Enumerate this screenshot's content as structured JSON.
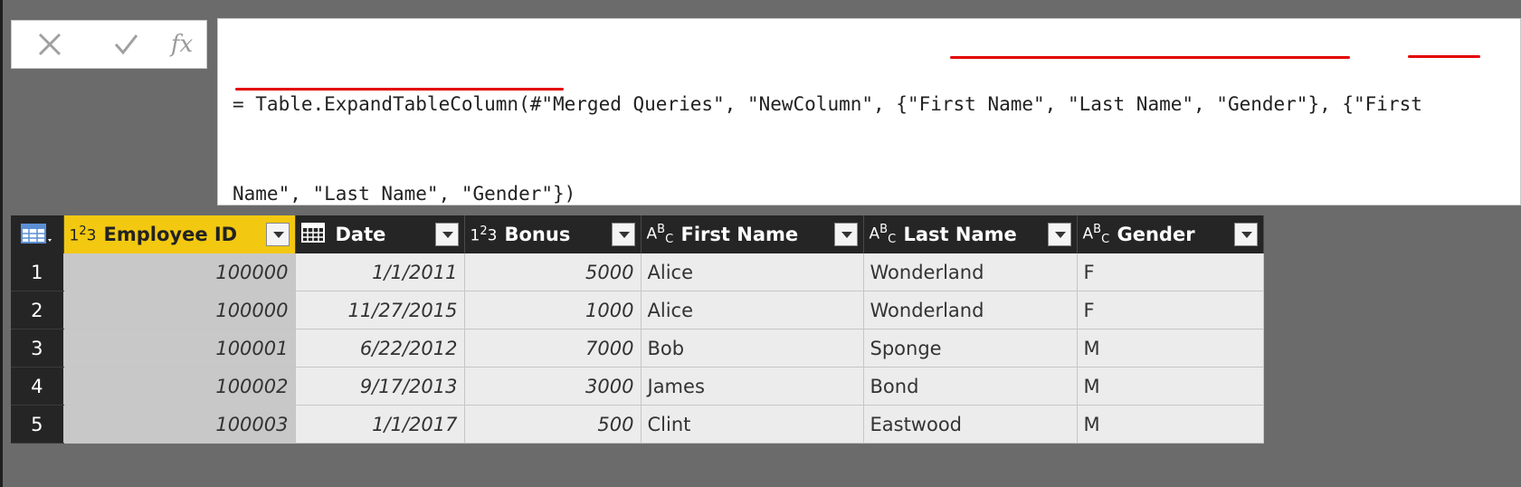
{
  "formula_bar": {
    "cancel_icon": "x-icon",
    "commit_icon": "checkmark-icon",
    "fx_label": "fx",
    "formula_line1": "= Table.ExpandTableColumn(#\"Merged Queries\", \"NewColumn\", {\"First Name\", \"Last Name\", \"Gender\"}, {\"First",
    "formula_line2": "Name\", \"Last Name\", \"Gender\"})",
    "highlight_color": "#e30000"
  },
  "table": {
    "columns": [
      {
        "label": "Employee ID",
        "type_icon": "whole-number-icon",
        "selected": true
      },
      {
        "label": "Date",
        "type_icon": "calendar-icon"
      },
      {
        "label": "Bonus",
        "type_icon": "whole-number-icon"
      },
      {
        "label": "First Name",
        "type_icon": "text-type-icon"
      },
      {
        "label": "Last Name",
        "type_icon": "text-type-icon"
      },
      {
        "label": "Gender",
        "type_icon": "text-type-icon"
      }
    ],
    "rows": [
      {
        "n": "1",
        "id": "100000",
        "date": "1/1/2011",
        "bonus": "5000",
        "first": "Alice",
        "last": "Wonderland",
        "gender": "F"
      },
      {
        "n": "2",
        "id": "100000",
        "date": "11/27/2015",
        "bonus": "1000",
        "first": "Alice",
        "last": "Wonderland",
        "gender": "F"
      },
      {
        "n": "3",
        "id": "100001",
        "date": "6/22/2012",
        "bonus": "7000",
        "first": "Bob",
        "last": "Sponge",
        "gender": "M"
      },
      {
        "n": "4",
        "id": "100002",
        "date": "9/17/2013",
        "bonus": "3000",
        "first": "James",
        "last": "Bond",
        "gender": "M"
      },
      {
        "n": "5",
        "id": "100003",
        "date": "1/1/2017",
        "bonus": "500",
        "first": "Clint",
        "last": "Eastwood",
        "gender": "M"
      }
    ],
    "selected_header_color": "#f2c811"
  }
}
